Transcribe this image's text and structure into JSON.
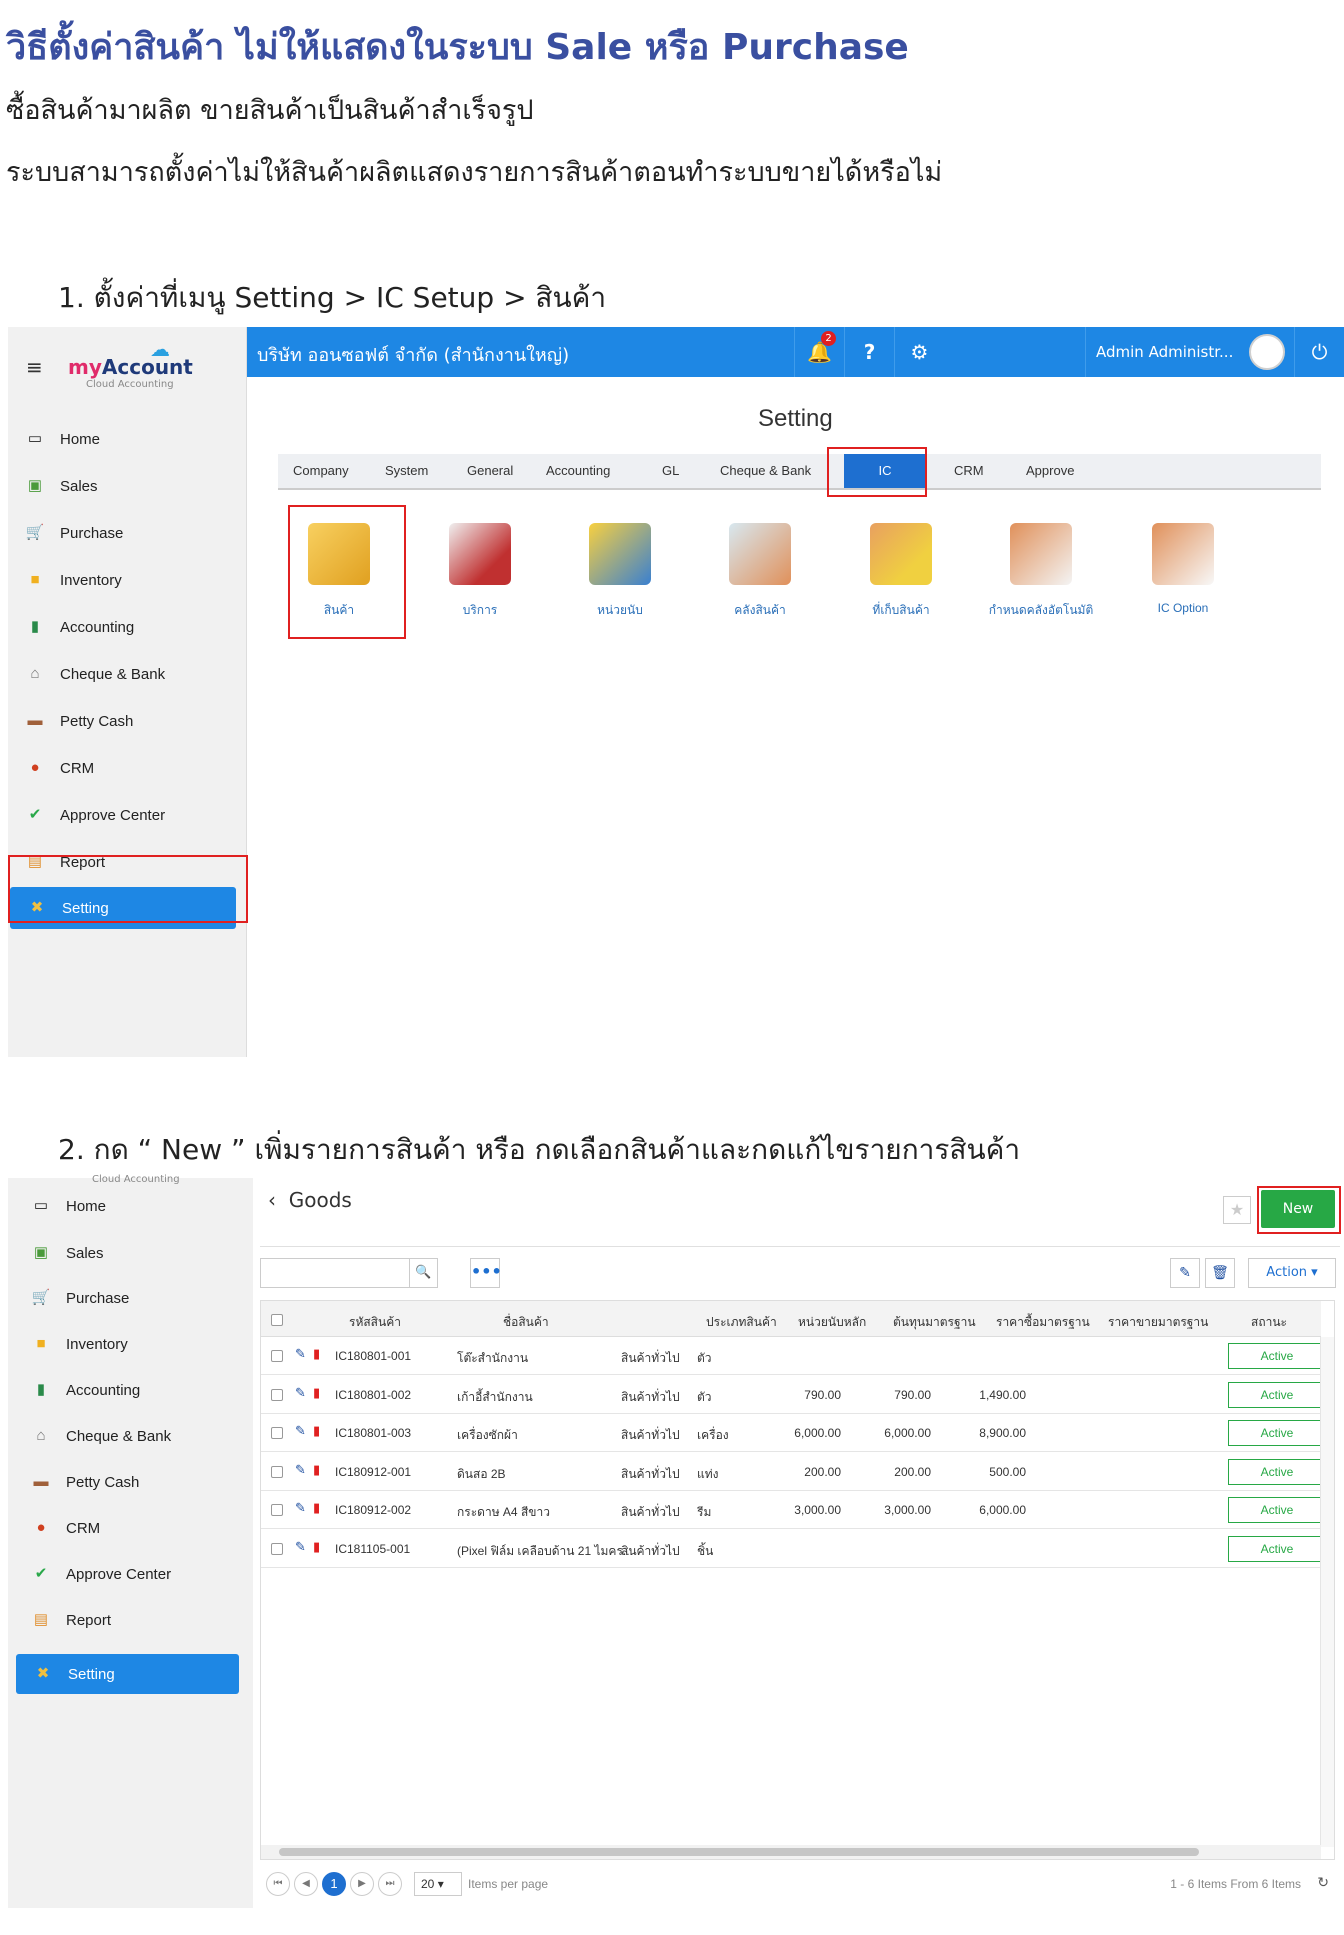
{
  "doc": {
    "title": "วิธีตั้งค่าสินค้า ไม่ให้แสดงในระบบ Sale หรือ Purchase",
    "line1": "ซื้อสินค้ามาผลิต ขายสินค้าเป็นสินค้าสำเร็จรูป",
    "line2": "ระบบสามารถตั้งค่าไม่ให้สินค้าผลิตแสดงรายการสินค้าตอนทำระบบขายได้หรือไม่",
    "step1": "1.   ตั้งค่าที่เมนู Setting > IC Setup > สินค้า",
    "step2": "2.   กด “ New ” เพิ่มรายการสินค้า หรือ กดเลือกสินค้าและกดแก้ไขรายการสินค้า"
  },
  "logo": {
    "my": "my",
    "account": "Account",
    "sub": "Cloud Accounting"
  },
  "sidebar": {
    "items": [
      {
        "label": "Home",
        "icon": "home-icon"
      },
      {
        "label": "Sales",
        "icon": "sales-icon"
      },
      {
        "label": "Purchase",
        "icon": "cart-icon"
      },
      {
        "label": "Inventory",
        "icon": "box-icon"
      },
      {
        "label": "Accounting",
        "icon": "book-icon"
      },
      {
        "label": "Cheque & Bank",
        "icon": "bank-icon"
      },
      {
        "label": "Petty Cash",
        "icon": "wallet-icon"
      },
      {
        "label": "CRM",
        "icon": "crm-icon"
      },
      {
        "label": "Approve Center",
        "icon": "check-circle-icon"
      },
      {
        "label": "Report",
        "icon": "report-icon"
      },
      {
        "label": "Setting",
        "icon": "tools-icon"
      }
    ]
  },
  "topbar": {
    "company": "บริษัท ออนซอฟต์ จำกัด (สำนักงานใหญ่)",
    "notif_count": "2",
    "help": "?",
    "user": "Admin Administr...",
    "brand_color": "#1e87e4"
  },
  "setting": {
    "title": "Setting",
    "tabs": [
      "Company",
      "System",
      "General",
      "Accounting",
      "GL",
      "Cheque & Bank",
      "IC",
      "CRM",
      "Approve"
    ],
    "active_tab": "IC",
    "icons": [
      {
        "label": "สินค้า",
        "icon": "goods-box-icon"
      },
      {
        "label": "บริการ",
        "icon": "service-person-icon"
      },
      {
        "label": "หน่วยนับ",
        "icon": "unit-folder-icon"
      },
      {
        "label": "คลังสินค้า",
        "icon": "warehouse-icon"
      },
      {
        "label": "ที่เก็บสินค้า",
        "icon": "storage-location-icon"
      },
      {
        "label": "กำหนดคลังอัตโนมัติ",
        "icon": "auto-warehouse-icon"
      },
      {
        "label": "IC Option",
        "icon": "ic-option-icon"
      }
    ]
  },
  "goods": {
    "back": "‹",
    "title": "Goods",
    "new_label": "New",
    "action_label": "Action",
    "more": "•••",
    "columns": [
      "รหัสสินค้า",
      "ชื่อสินค้า",
      "ประเภทสินค้า",
      "หน่วยนับหลัก",
      "ต้นทุนมาตรฐาน",
      "ราคาซื้อมาตรฐาน",
      "ราคาขายมาตรฐาน",
      "สถานะ"
    ],
    "rows": [
      {
        "code": "IC180801-001",
        "name": "โต๊ะสำนักงาน",
        "type": "สินค้าทั่วไป",
        "unit": "ตัว",
        "cost": "",
        "buy": "",
        "sell": "",
        "status": "Active"
      },
      {
        "code": "IC180801-002",
        "name": "เก้าอี้สำนักงาน",
        "type": "สินค้าทั่วไป",
        "unit": "ตัว",
        "cost": "790.00",
        "buy": "790.00",
        "sell": "1,490.00",
        "status": "Active"
      },
      {
        "code": "IC180801-003",
        "name": "เครื่องซักผ้า",
        "type": "สินค้าทั่วไป",
        "unit": "เครื่อง",
        "cost": "6,000.00",
        "buy": "6,000.00",
        "sell": "8,900.00",
        "status": "Active"
      },
      {
        "code": "IC180912-001",
        "name": "ดินสอ 2B",
        "type": "สินค้าทั่วไป",
        "unit": "แท่ง",
        "cost": "200.00",
        "buy": "200.00",
        "sell": "500.00",
        "status": "Active"
      },
      {
        "code": "IC180912-002",
        "name": "กระดาษ A4 สีขาว",
        "type": "สินค้าทั่วไป",
        "unit": "รีม",
        "cost": "3,000.00",
        "buy": "3,000.00",
        "sell": "6,000.00",
        "status": "Active"
      },
      {
        "code": "IC181105-001",
        "name": "(Pixel ฟิล์ม เคลือบด้าน 21 ไมคร...",
        "type": "สินค้าทั่วไป",
        "unit": "ชิ้น",
        "cost": "",
        "buy": "",
        "sell": "",
        "status": "Active"
      }
    ],
    "pager": {
      "page": "1",
      "page_size": "20",
      "items_per_page": "Items per page",
      "summary": "1 - 6 Items From 6 Items"
    }
  }
}
